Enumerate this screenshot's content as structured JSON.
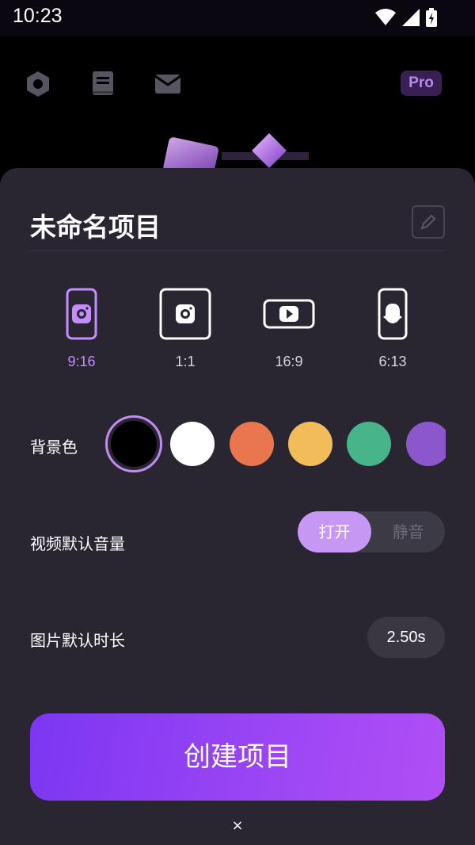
{
  "status_bar": {
    "time": "10:23"
  },
  "top_bar": {
    "pro_label": "Pro"
  },
  "sheet": {
    "title": "未命名项目",
    "ratios": [
      {
        "label": "9:16",
        "platform": "instagram",
        "selected": true
      },
      {
        "label": "1:1",
        "platform": "instagram",
        "selected": false
      },
      {
        "label": "16:9",
        "platform": "youtube",
        "selected": false
      },
      {
        "label": "6:13",
        "platform": "snapchat",
        "selected": false
      }
    ],
    "background_color": {
      "label": "背景色",
      "colors": [
        "#000000",
        "#ffffff",
        "#ea7650",
        "#f2bd59",
        "#47b48a",
        "#8d57cc"
      ],
      "selected_index": 0
    },
    "video_volume": {
      "label": "视频默认音量",
      "on_label": "打开",
      "off_label": "静音",
      "value": "on"
    },
    "image_duration": {
      "label": "图片默认时长",
      "value": "2.50s"
    },
    "create_button": "创建项目",
    "close_label": "×"
  },
  "colors": {
    "accent": "#c48cff",
    "sheet_bg": "#292632",
    "button_start": "#7c36f2",
    "button_end": "#b04ff5"
  }
}
